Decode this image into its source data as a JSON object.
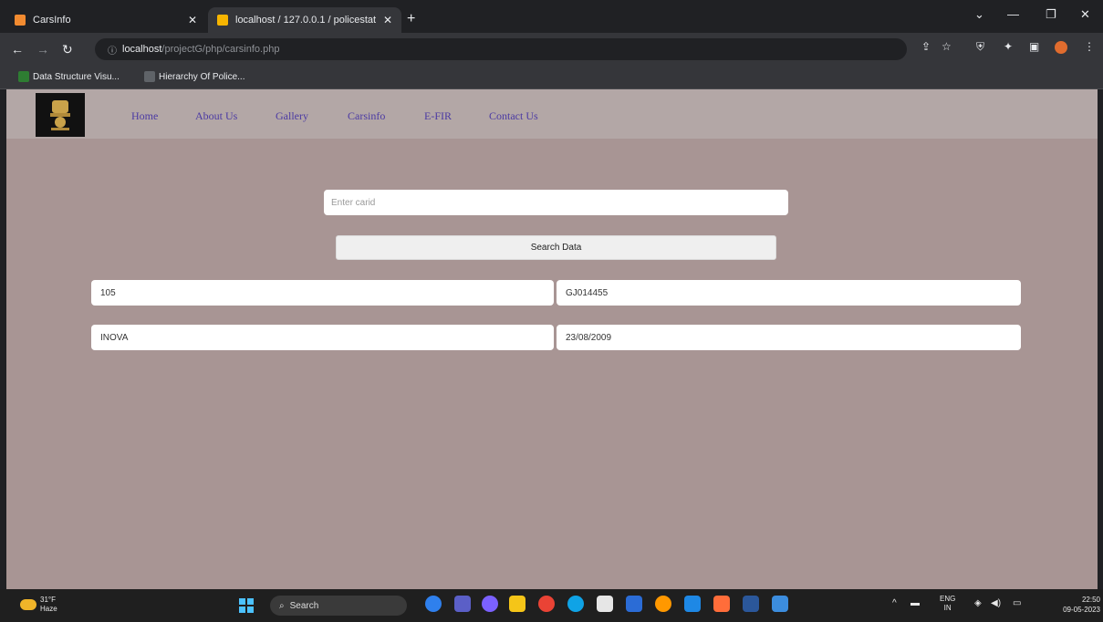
{
  "browser": {
    "tabs": [
      {
        "label": "CarsInfo",
        "active": false,
        "favicon_color": "#f28b30"
      },
      {
        "label": "localhost / 127.0.0.1 / policestat",
        "active": true,
        "favicon_color": "#f7b500"
      }
    ],
    "url_host": "localhost",
    "url_path": "/projectG/php/carsinfo.php",
    "bookmarks": [
      {
        "label": "Data Structure Visu...",
        "icon_color": "#2e7d32"
      },
      {
        "label": "Hierarchy Of Police...",
        "icon_color": "#5f6368"
      }
    ]
  },
  "site": {
    "nav_items": [
      "Home",
      "About Us",
      "Gallery",
      "Carsinfo",
      "E-FIR",
      "Contact Us"
    ]
  },
  "form": {
    "card_placeholder": "Enter carid",
    "search_label": "Search Data"
  },
  "results": {
    "car_id": "105",
    "reg_number": "GJ014455",
    "model": "INOVA",
    "date": "23/08/2009"
  },
  "taskbar": {
    "weather_temp": "31°F",
    "weather_desc": "Haze",
    "search_label": "Search",
    "lang_top": "ENG",
    "lang_bottom": "IN",
    "time": "22:50",
    "date": "09-05-2023"
  },
  "colors": {
    "page_bg": "#a89594",
    "navbar_bg": "#b3a7a6",
    "nav_link": "#4b3aa3"
  }
}
